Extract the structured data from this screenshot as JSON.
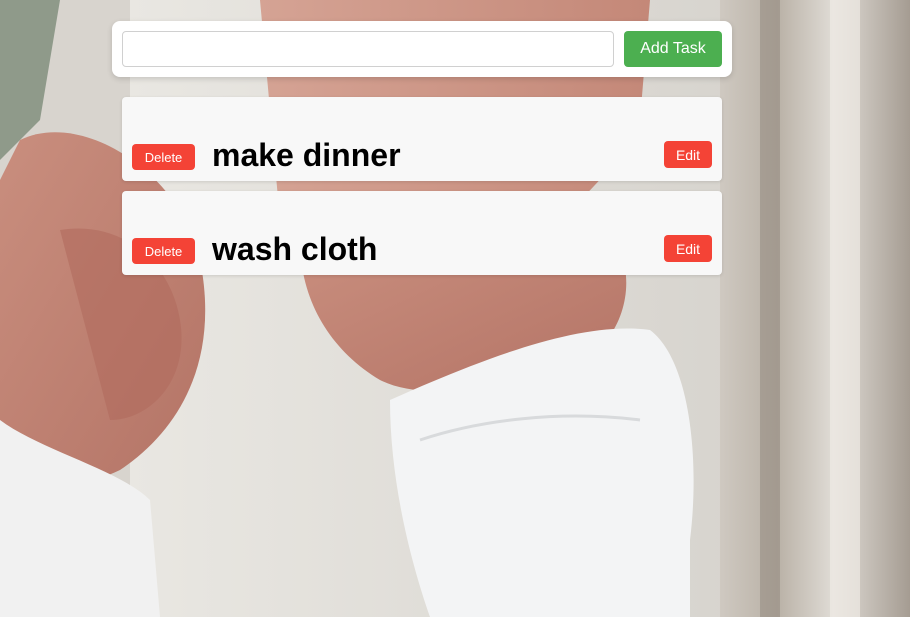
{
  "input": {
    "value": "",
    "placeholder": ""
  },
  "add_button_label": "Add Task",
  "tasks": [
    {
      "text": "make dinner",
      "delete_label": "Delete",
      "edit_label": "Edit"
    },
    {
      "text": "wash cloth",
      "delete_label": "Delete",
      "edit_label": "Edit"
    }
  ],
  "colors": {
    "add_button": "#4caf50",
    "delete_button": "#f44336",
    "edit_button": "#f44336",
    "task_bg": "#f8f8f8"
  }
}
